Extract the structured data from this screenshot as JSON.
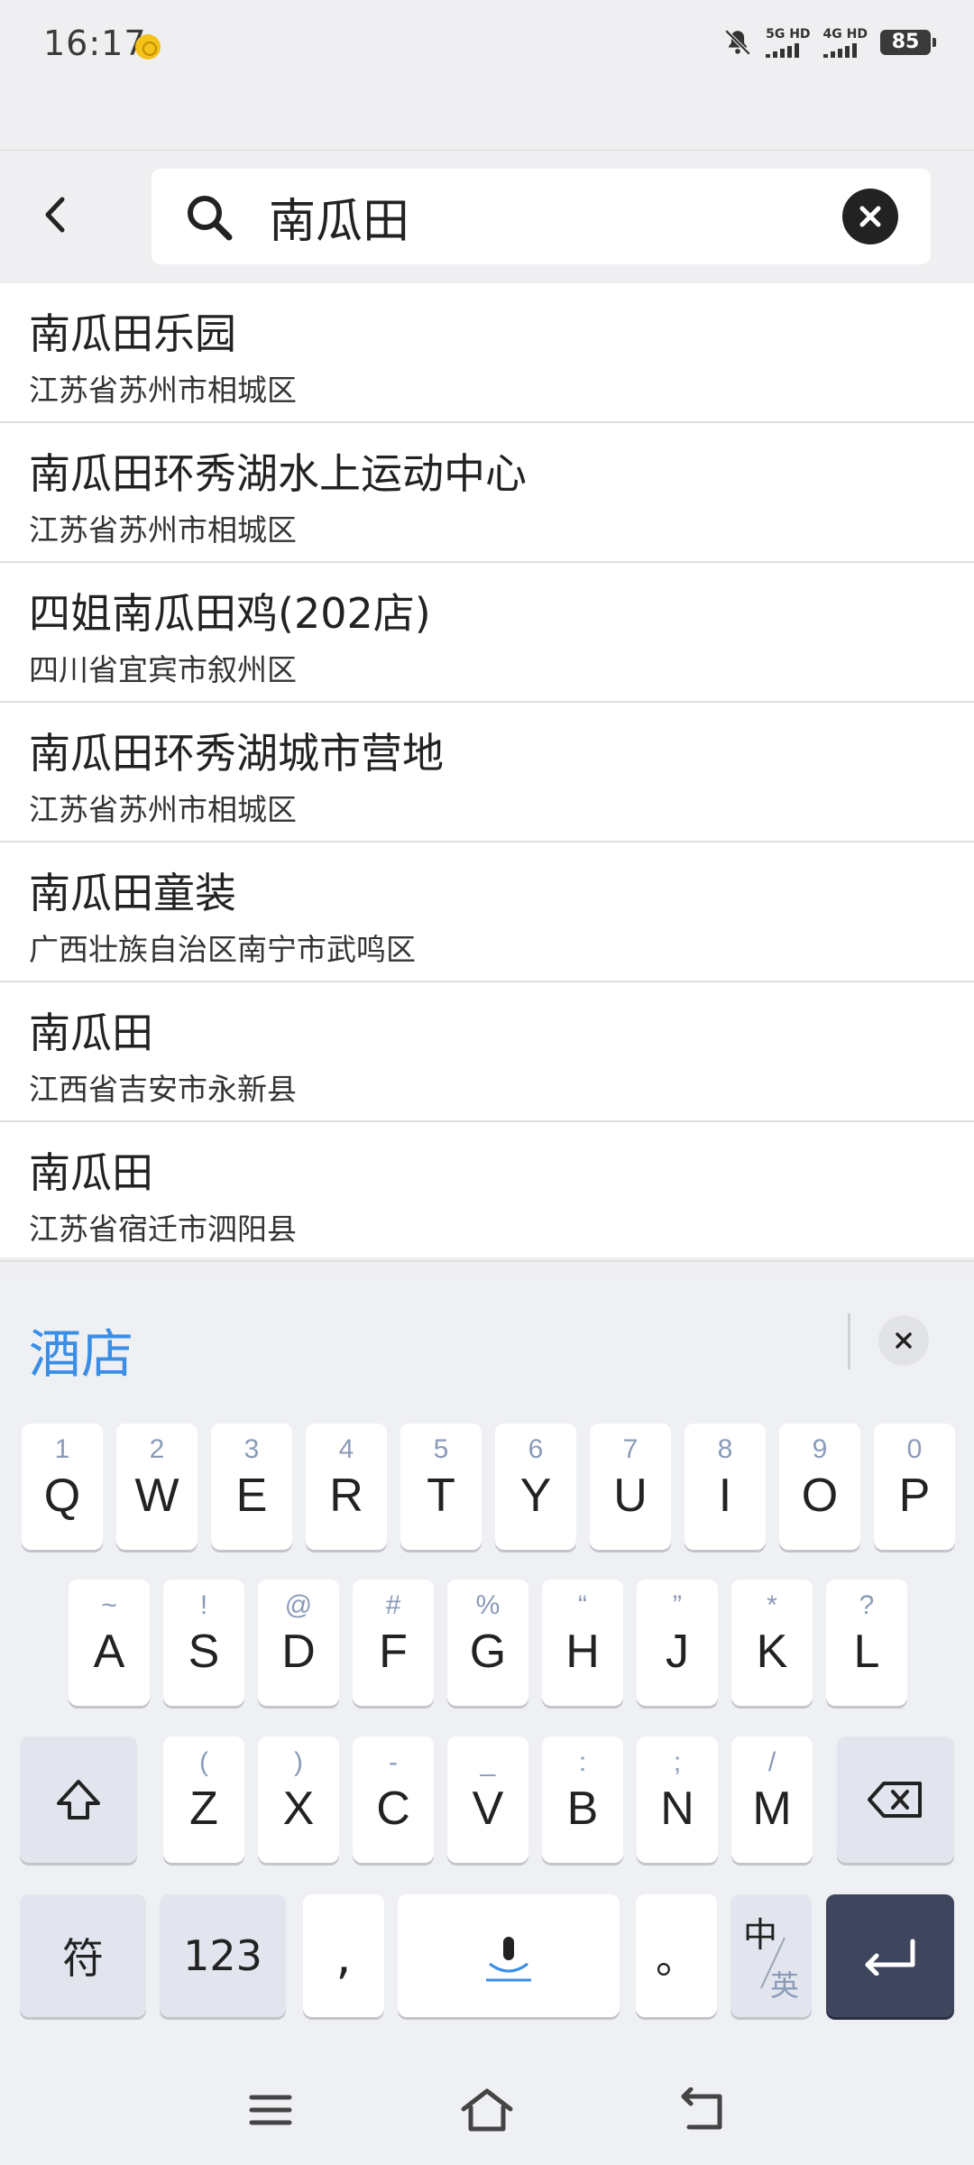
{
  "status_bar": {
    "time": "16:17",
    "net1": "5G HD",
    "net2": "4G HD",
    "battery": "85"
  },
  "search": {
    "query": "南瓜田"
  },
  "results": [
    {
      "name": "南瓜田乐园",
      "address": "江苏省苏州市相城区"
    },
    {
      "name": "南瓜田环秀湖水上运动中心",
      "address": "江苏省苏州市相城区"
    },
    {
      "name": "四姐南瓜田鸡(202店)",
      "address": "四川省宜宾市叙州区"
    },
    {
      "name": "南瓜田环秀湖城市营地",
      "address": "江苏省苏州市相城区"
    },
    {
      "name": "南瓜田童装",
      "address": "广西壮族自治区南宁市武鸣区"
    },
    {
      "name": "南瓜田",
      "address": "江西省吉安市永新县"
    },
    {
      "name": "南瓜田",
      "address": "江苏省宿迁市泗阳县"
    }
  ],
  "keyboard": {
    "suggestion": "酒店",
    "row1": [
      {
        "main": "Q",
        "sub": "1"
      },
      {
        "main": "W",
        "sub": "2"
      },
      {
        "main": "E",
        "sub": "3"
      },
      {
        "main": "R",
        "sub": "4"
      },
      {
        "main": "T",
        "sub": "5"
      },
      {
        "main": "Y",
        "sub": "6"
      },
      {
        "main": "U",
        "sub": "7"
      },
      {
        "main": "I",
        "sub": "8"
      },
      {
        "main": "O",
        "sub": "9"
      },
      {
        "main": "P",
        "sub": "0"
      }
    ],
    "row2": [
      {
        "main": "A",
        "sub": "~"
      },
      {
        "main": "S",
        "sub": "!"
      },
      {
        "main": "D",
        "sub": "@"
      },
      {
        "main": "F",
        "sub": "#"
      },
      {
        "main": "G",
        "sub": "%"
      },
      {
        "main": "H",
        "sub": "“"
      },
      {
        "main": "J",
        "sub": "”"
      },
      {
        "main": "K",
        "sub": "*"
      },
      {
        "main": "L",
        "sub": "?"
      }
    ],
    "row3": [
      {
        "main": "Z",
        "sub": "("
      },
      {
        "main": "X",
        "sub": ")"
      },
      {
        "main": "C",
        "sub": "-"
      },
      {
        "main": "V",
        "sub": "_"
      },
      {
        "main": "B",
        "sub": ":"
      },
      {
        "main": "N",
        "sub": ";"
      },
      {
        "main": "M",
        "sub": "/"
      }
    ],
    "symbol_key": "符",
    "num_key": "123",
    "comma_key": ",",
    "period_key": "。",
    "lang_key_top": "中",
    "lang_key_bottom": "英"
  }
}
